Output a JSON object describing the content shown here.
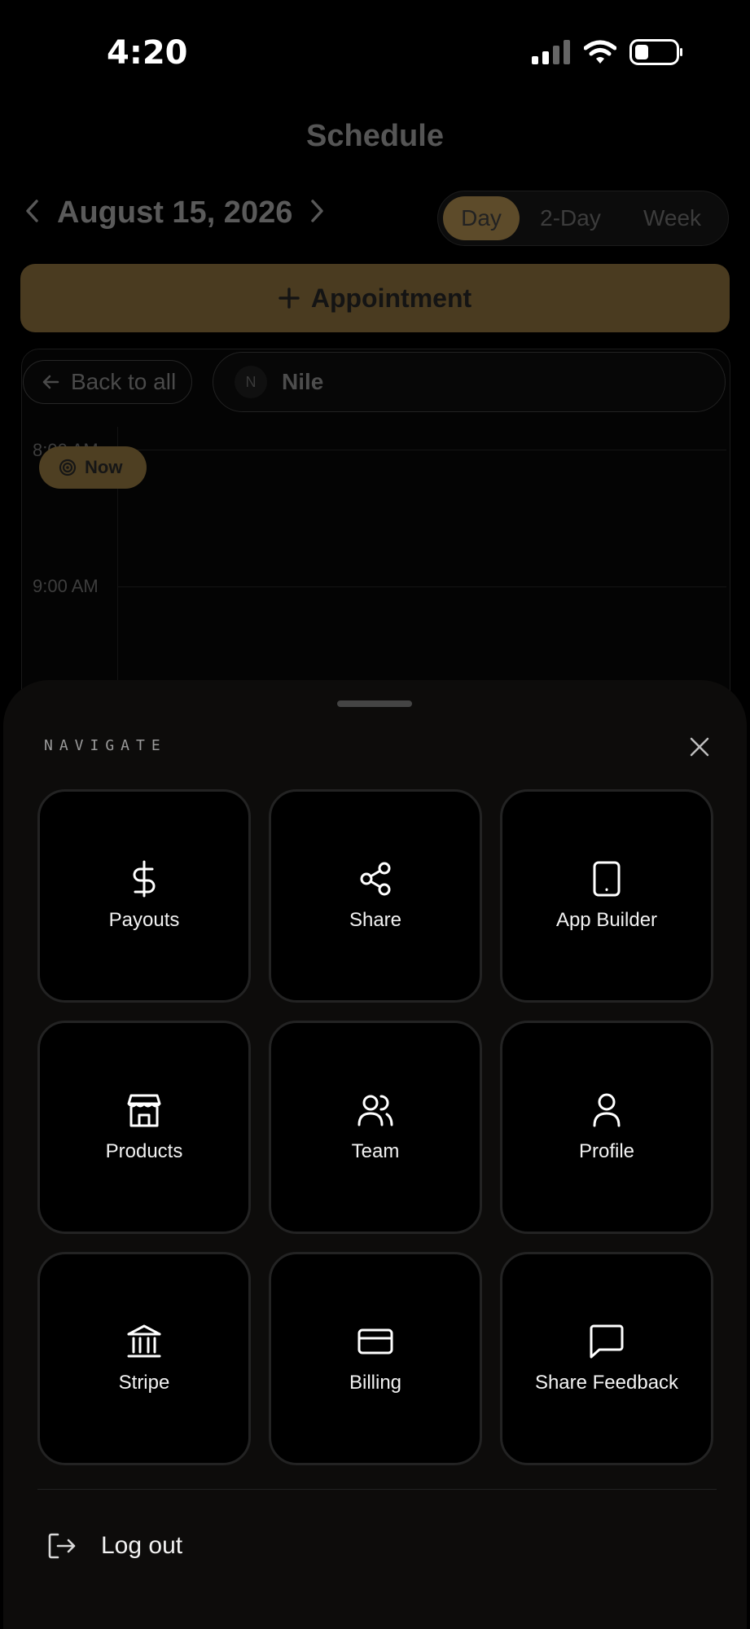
{
  "status_bar": {
    "time": "4:20"
  },
  "header": {
    "title": "Schedule"
  },
  "date_nav": {
    "date": "August 15, 2026"
  },
  "view_toggle": {
    "options": [
      "Day",
      "2-Day",
      "Week"
    ],
    "selected": "Day"
  },
  "actions": {
    "appointment_label": "Appointment"
  },
  "filter": {
    "back_label": "Back to all",
    "staff_initial": "N",
    "staff_name": "Nile"
  },
  "calendar": {
    "times": [
      "8:00 AM",
      "9:00 AM"
    ],
    "now_label": "Now"
  },
  "nav_sheet": {
    "heading": "NAVIGATE",
    "items": [
      {
        "label": "Payouts",
        "icon": "dollar-icon"
      },
      {
        "label": "Share",
        "icon": "share-icon"
      },
      {
        "label": "App Builder",
        "icon": "tablet-icon"
      },
      {
        "label": "Products",
        "icon": "store-icon"
      },
      {
        "label": "Team",
        "icon": "users-icon"
      },
      {
        "label": "Profile",
        "icon": "user-icon"
      },
      {
        "label": "Stripe",
        "icon": "bank-icon"
      },
      {
        "label": "Billing",
        "icon": "credit-card-icon"
      },
      {
        "label": "Share Feedback",
        "icon": "message-icon"
      }
    ],
    "logout_label": "Log out"
  },
  "colors": {
    "accent": "#5d4b2a",
    "sheet_bg": "#0d0c0b",
    "tile_border": "#232323"
  }
}
